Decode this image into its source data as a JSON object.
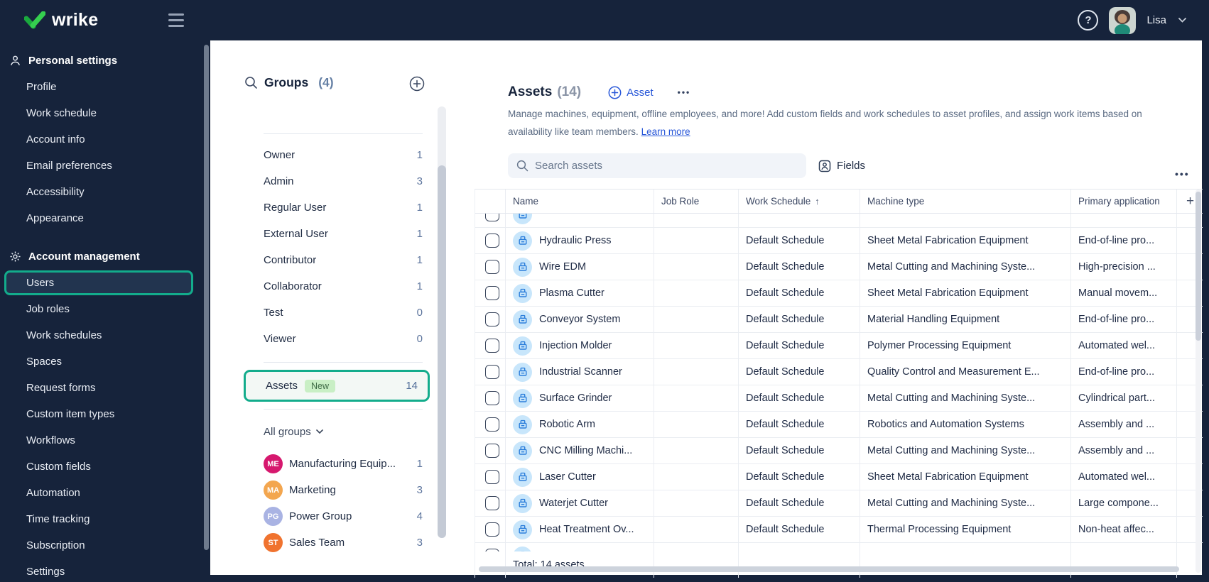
{
  "topbar": {
    "brand": "wrike",
    "help_label": "?",
    "user_name": "Lisa"
  },
  "icons": {
    "ellipsis": "•••",
    "sort_up": "↑",
    "plus": "+"
  },
  "sidebar": {
    "sections": [
      {
        "label": "Personal settings",
        "icon": "person",
        "selected": "",
        "items": [
          "Profile",
          "Work schedule",
          "Account info",
          "Email preferences",
          "Accessibility",
          "Appearance"
        ]
      },
      {
        "label": "Account management",
        "icon": "gear",
        "selected": "Users",
        "items": [
          "Users",
          "Job roles",
          "Work schedules",
          "Spaces",
          "Request forms",
          "Custom item types",
          "Workflows",
          "Custom fields",
          "Automation",
          "Time tracking",
          "Subscription",
          "Settings"
        ]
      }
    ]
  },
  "groups_panel": {
    "title": "Groups",
    "count": "(4)",
    "roles": [
      {
        "label": "Owner",
        "count": "1"
      },
      {
        "label": "Admin",
        "count": "3"
      },
      {
        "label": "Regular User",
        "count": "1"
      },
      {
        "label": "External User",
        "count": "1"
      },
      {
        "label": "Contributor",
        "count": "1"
      },
      {
        "label": "Collaborator",
        "count": "1"
      },
      {
        "label": "Test",
        "count": "0"
      },
      {
        "label": "Viewer",
        "count": "0"
      }
    ],
    "assets_row": {
      "label": "Assets",
      "badge": "New",
      "count": "14"
    },
    "filter_label": "All groups",
    "groups": [
      {
        "initials": "ME",
        "label": "Manufacturing Equip...",
        "count": "1",
        "color": "#d6186e"
      },
      {
        "initials": "MA",
        "label": "Marketing",
        "count": "3",
        "color": "#f3a64f"
      },
      {
        "initials": "PG",
        "label": "Power Group",
        "count": "4",
        "color": "#a9b3e3"
      },
      {
        "initials": "ST",
        "label": "Sales Team",
        "count": "3",
        "color": "#f0732f"
      }
    ]
  },
  "main": {
    "title": "Assets",
    "count": "(14)",
    "add_button": "Asset",
    "description_line1": "Manage machines, equipment, offline employees, and more! Add custom fields and work schedules to asset profiles, and assign work items based on",
    "description_line2": "availability like team members.",
    "learn_more": "Learn more",
    "search_placeholder": "Search assets",
    "fields_button": "Fields",
    "table": {
      "columns": [
        "Name",
        "Job Role",
        "Work Schedule",
        "Machine type",
        "Primary application"
      ],
      "sort_column": "Work Schedule",
      "rows": [
        {
          "name": "Hydraulic Press",
          "job_role": "",
          "work_schedule": "Default Schedule",
          "machine_type": "Sheet Metal Fabrication Equipment",
          "primary_application": "End-of-line pro..."
        },
        {
          "name": "Wire EDM",
          "job_role": "",
          "work_schedule": "Default Schedule",
          "machine_type": "Metal Cutting and Machining Syste...",
          "primary_application": "High-precision ..."
        },
        {
          "name": "Plasma Cutter",
          "job_role": "",
          "work_schedule": "Default Schedule",
          "machine_type": "Sheet Metal Fabrication Equipment",
          "primary_application": "Manual movem..."
        },
        {
          "name": "Conveyor System",
          "job_role": "",
          "work_schedule": "Default Schedule",
          "machine_type": "Material Handling Equipment",
          "primary_application": "End-of-line pro..."
        },
        {
          "name": "Injection Molder",
          "job_role": "",
          "work_schedule": "Default Schedule",
          "machine_type": "Polymer Processing Equipment",
          "primary_application": "Automated wel..."
        },
        {
          "name": "Industrial Scanner",
          "job_role": "",
          "work_schedule": "Default Schedule",
          "machine_type": "Quality Control and Measurement E...",
          "primary_application": "End-of-line pro..."
        },
        {
          "name": "Surface Grinder",
          "job_role": "",
          "work_schedule": "Default Schedule",
          "machine_type": "Metal Cutting and Machining Syste...",
          "primary_application": "Cylindrical part..."
        },
        {
          "name": "Robotic Arm",
          "job_role": "",
          "work_schedule": "Default Schedule",
          "machine_type": "Robotics and Automation Systems",
          "primary_application": "Assembly and ..."
        },
        {
          "name": "CNC Milling Machi...",
          "job_role": "",
          "work_schedule": "Default Schedule",
          "machine_type": "Metal Cutting and Machining Syste...",
          "primary_application": "Assembly and ..."
        },
        {
          "name": "Laser Cutter",
          "job_role": "",
          "work_schedule": "Default Schedule",
          "machine_type": "Sheet Metal Fabrication Equipment",
          "primary_application": "Automated wel..."
        },
        {
          "name": "Waterjet Cutter",
          "job_role": "",
          "work_schedule": "Default Schedule",
          "machine_type": "Metal Cutting and Machining Syste...",
          "primary_application": "Large compone..."
        },
        {
          "name": "Heat Treatment Ov...",
          "job_role": "",
          "work_schedule": "Default Schedule",
          "machine_type": "Thermal Processing Equipment",
          "primary_application": "Non-heat affec..."
        }
      ],
      "total": "Total: 14 assets"
    }
  },
  "colors": {
    "navy": "#16233b",
    "accent_teal": "#13ac8c",
    "accent_blue": "#2857d8",
    "badge_green_bg": "#c9efc5",
    "asset_avatar_bg": "#c8e6fb"
  }
}
